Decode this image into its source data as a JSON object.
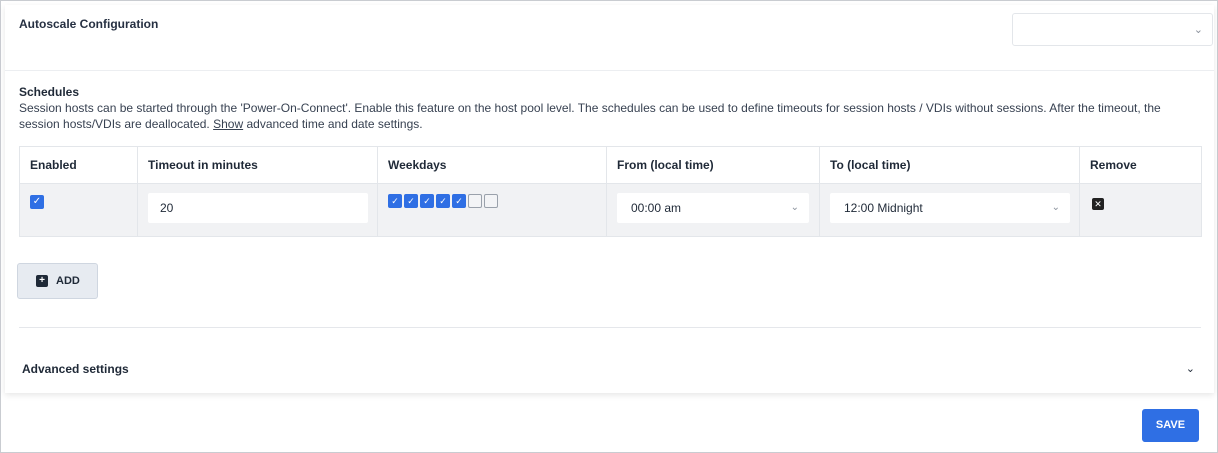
{
  "header": {
    "title": "Autoscale Configuration",
    "select_value": ""
  },
  "schedules": {
    "title": "Schedules",
    "description_before_link": "Session hosts can be started through the 'Power-On-Connect'. Enable this feature on the host pool level. The schedules can be used to define timeouts for session hosts / VDIs without sessions. After the timeout, the session hosts/VDIs are deallocated. ",
    "link_text": "Show",
    "description_after_link": " advanced time and date settings.",
    "columns": [
      "Enabled",
      "Timeout in minutes",
      "Weekdays",
      "From (local time)",
      "To (local time)",
      "Remove"
    ],
    "rows": [
      {
        "enabled": true,
        "timeout": "20",
        "weekdays": [
          true,
          true,
          true,
          true,
          true,
          false,
          false
        ],
        "from": "00:00 am",
        "to": "12:00 Midnight"
      }
    ]
  },
  "add_label": "ADD",
  "advanced_label": "Advanced settings",
  "save_label": "SAVE",
  "icons": {
    "check": "✓",
    "chevron": "⌄",
    "plus": "+",
    "remove": "✕"
  },
  "colors": {
    "accent": "#2f6fe4",
    "row_bg": "#f1f2f4"
  }
}
